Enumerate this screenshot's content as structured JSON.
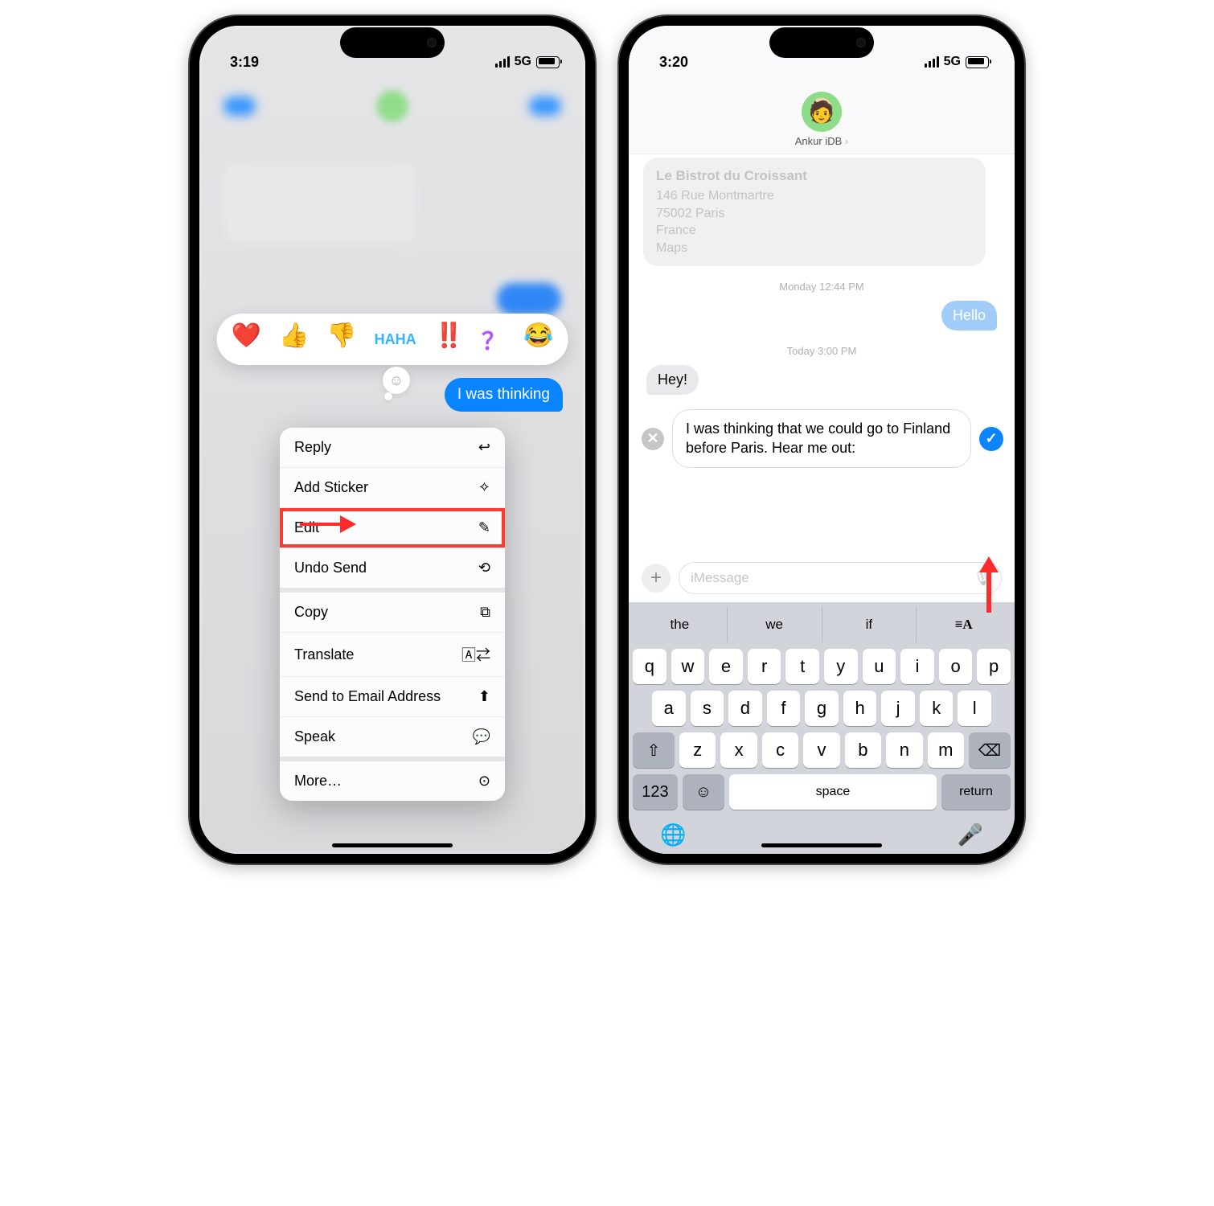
{
  "phone1": {
    "statusTime": "3:19",
    "network": "5G",
    "tapbacks": [
      "❤️",
      "👍",
      "👎",
      "HAHA",
      "‼️",
      "？",
      "😂"
    ],
    "focusedMessage": "I was thinking",
    "menu": {
      "reply": "Reply",
      "addSticker": "Add Sticker",
      "edit": "Edit",
      "undoSend": "Undo Send",
      "copy": "Copy",
      "translate": "Translate",
      "sendEmail": "Send to Email Address",
      "speak": "Speak",
      "more": "More…"
    }
  },
  "phone2": {
    "statusTime": "3:20",
    "network": "5G",
    "contactName": "Ankur iDB",
    "mapCard": {
      "title": "Le Bistrot du Croissant",
      "line1": "146 Rue Montmartre",
      "line2": "75002 Paris",
      "line3": "France",
      "source": "Maps"
    },
    "sep1": "Monday 12:44 PM",
    "bubbleHello": "Hello",
    "sep2": "Today 3:00 PM",
    "bubbleHey": "Hey!",
    "editingText": "I was thinking that we could go to Finland before Paris. Hear me out:",
    "composePlaceholder": "iMessage",
    "predictions": [
      "the",
      "we",
      "if"
    ],
    "keys": {
      "row1": [
        "q",
        "w",
        "e",
        "r",
        "t",
        "y",
        "u",
        "i",
        "o",
        "p"
      ],
      "row2": [
        "a",
        "s",
        "d",
        "f",
        "g",
        "h",
        "j",
        "k",
        "l"
      ],
      "row3": [
        "z",
        "x",
        "c",
        "v",
        "b",
        "n",
        "m"
      ],
      "numKey": "123",
      "spaceKey": "space",
      "returnKey": "return"
    }
  }
}
